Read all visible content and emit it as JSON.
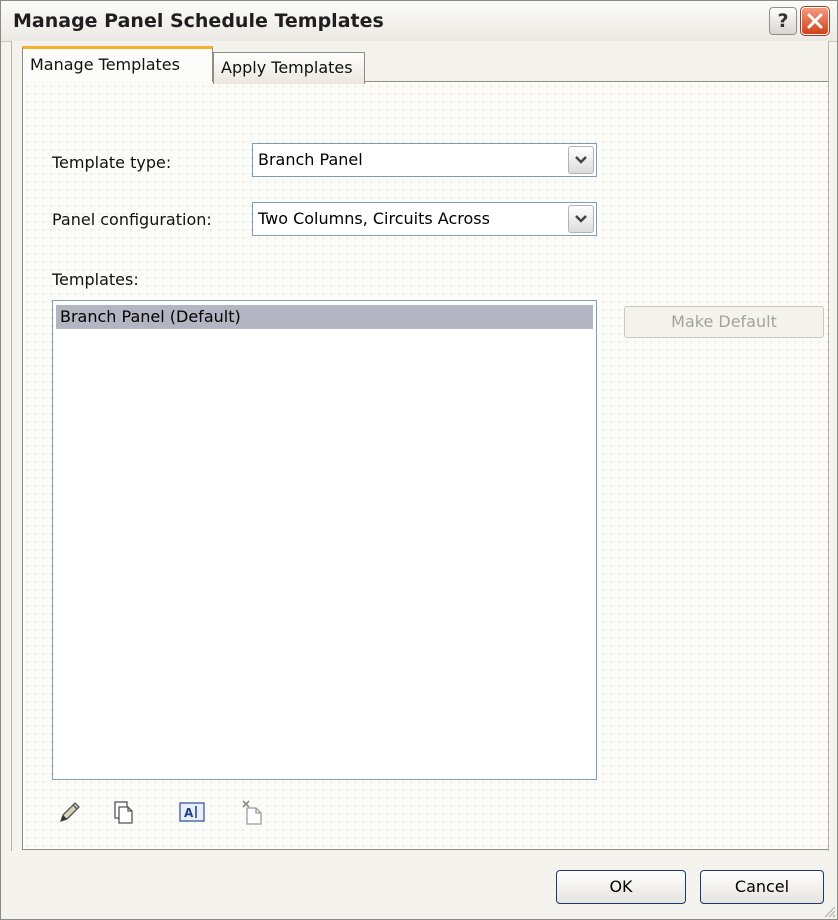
{
  "window": {
    "title": "Manage Panel Schedule Templates",
    "help_glyph": "?",
    "close_glyph": "✕"
  },
  "tabs": [
    {
      "label": "Manage Templates",
      "active": true
    },
    {
      "label": "Apply Templates",
      "active": false
    }
  ],
  "form": {
    "template_type_label": "Template type:",
    "template_type_value": "Branch Panel",
    "panel_config_label": "Panel configuration:",
    "panel_config_value": "Two Columns, Circuits Across",
    "templates_label": "Templates:"
  },
  "templates": [
    {
      "name": "Branch Panel (Default)",
      "selected": true
    }
  ],
  "buttons": {
    "make_default": "Make Default",
    "ok": "OK",
    "cancel": "Cancel"
  },
  "toolbar_icons": [
    "pencil-icon",
    "duplicate-icon",
    "rename-icon",
    "delete-icon"
  ],
  "colors": {
    "tab_accent": "#f5b12a",
    "selection": "#b5b4c2",
    "close_button": "#d2421c"
  }
}
